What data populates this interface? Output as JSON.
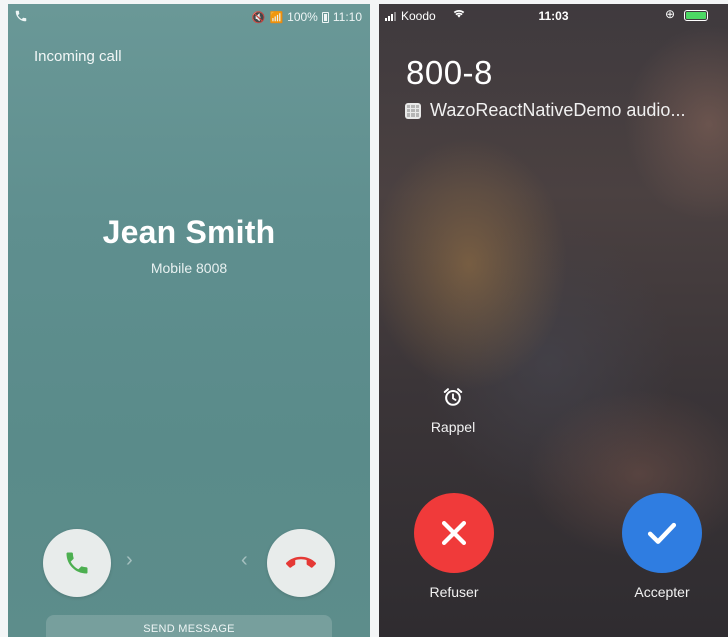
{
  "android": {
    "status_bar": {
      "mute_glyph": "🔇",
      "wifi_glyph": "📶",
      "battery_percent": "100%",
      "time": "11:10"
    },
    "incoming_label": "Incoming call",
    "caller_name": "Jean Smith",
    "caller_detail": "Mobile  8008",
    "answer_icon": "phone-answer-icon",
    "decline_icon": "phone-hangup-icon",
    "swipe_right_glyph": "›",
    "swipe_left_glyph": "‹",
    "send_message_label": "SEND MESSAGE",
    "colors": {
      "background": "#5f8f8f",
      "answer": "#4caf50",
      "decline": "#e53935"
    }
  },
  "ios": {
    "status_bar": {
      "carrier": "Koodo",
      "time": "11:03",
      "lock_glyph": "⊕"
    },
    "caller_number": "800-8",
    "app_label": "WazoReactNativeDemo audio...",
    "remind_label": "Rappel",
    "decline_label": "Refuser",
    "accept_label": "Accepter",
    "colors": {
      "decline": "#f03a3a",
      "accept": "#2f7de1",
      "battery": "#4cd964"
    }
  }
}
